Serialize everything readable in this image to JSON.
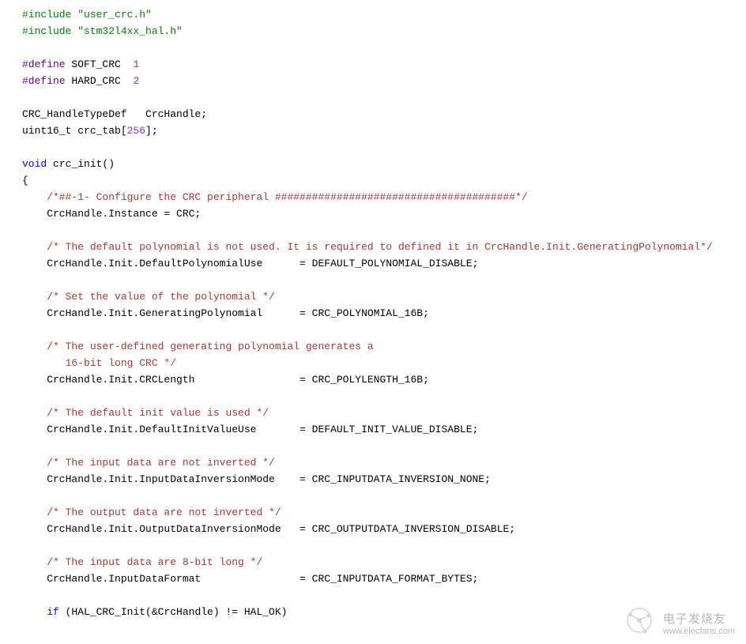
{
  "code": {
    "inc1_a": "#include ",
    "inc1_b": "\"user_crc.h\"",
    "inc2_a": "#include ",
    "inc2_b": "\"stm32l4xx_hal.h\"",
    "def1_a": "#define",
    "def1_b": " SOFT_CRC  ",
    "def1_c": "1",
    "def2_a": "#define",
    "def2_b": " HARD_CRC  ",
    "def2_c": "2",
    "decl1": "CRC_HandleTypeDef   CrcHandle;",
    "decl2_a": "uint16_t crc_tab[",
    "decl2_b": "256",
    "decl2_c": "];",
    "fn_a": "void",
    "fn_b": " crc_init()",
    "brace_open": "{",
    "c1": "    /*##-1- Configure the CRC peripheral #######################################*/",
    "l1": "    CrcHandle.Instance = CRC;",
    "c2": "    /* The default polynomial is not used. It is required to defined it in CrcHandle.Init.GeneratingPolynomial*/",
    "l2": "    CrcHandle.Init.DefaultPolynomialUse      = DEFAULT_POLYNOMIAL_DISABLE;",
    "c3": "    /* Set the value of the polynomial */",
    "l3": "    CrcHandle.Init.GeneratingPolynomial      = CRC_POLYNOMIAL_16B;",
    "c4a": "    /* The user-defined generating polynomial generates a",
    "c4b": "       16-bit long CRC */",
    "l4": "    CrcHandle.Init.CRCLength                 = CRC_POLYLENGTH_16B;",
    "c5": "    /* The default init value is used */",
    "l5": "    CrcHandle.Init.DefaultInitValueUse       = DEFAULT_INIT_VALUE_DISABLE;",
    "c6": "    /* The input data are not inverted */",
    "l6": "    CrcHandle.Init.InputDataInversionMode    = CRC_INPUTDATA_INVERSION_NONE;",
    "c7": "    /* The output data are not inverted */",
    "l7": "    CrcHandle.Init.OutputDataInversionMode   = CRC_OUTPUTDATA_INVERSION_DISABLE;",
    "c8": "    /* The input data are 8-bit long */",
    "l8": "    CrcHandle.InputDataFormat                = CRC_INPUTDATA_FORMAT_BYTES;",
    "lif_a": "    if",
    "lif_b": " (HAL_CRC_Init(&CrcHandle) != HAL_OK)"
  },
  "watermark": {
    "chinese": "电子发烧友",
    "url": "www.elecfans.com"
  }
}
